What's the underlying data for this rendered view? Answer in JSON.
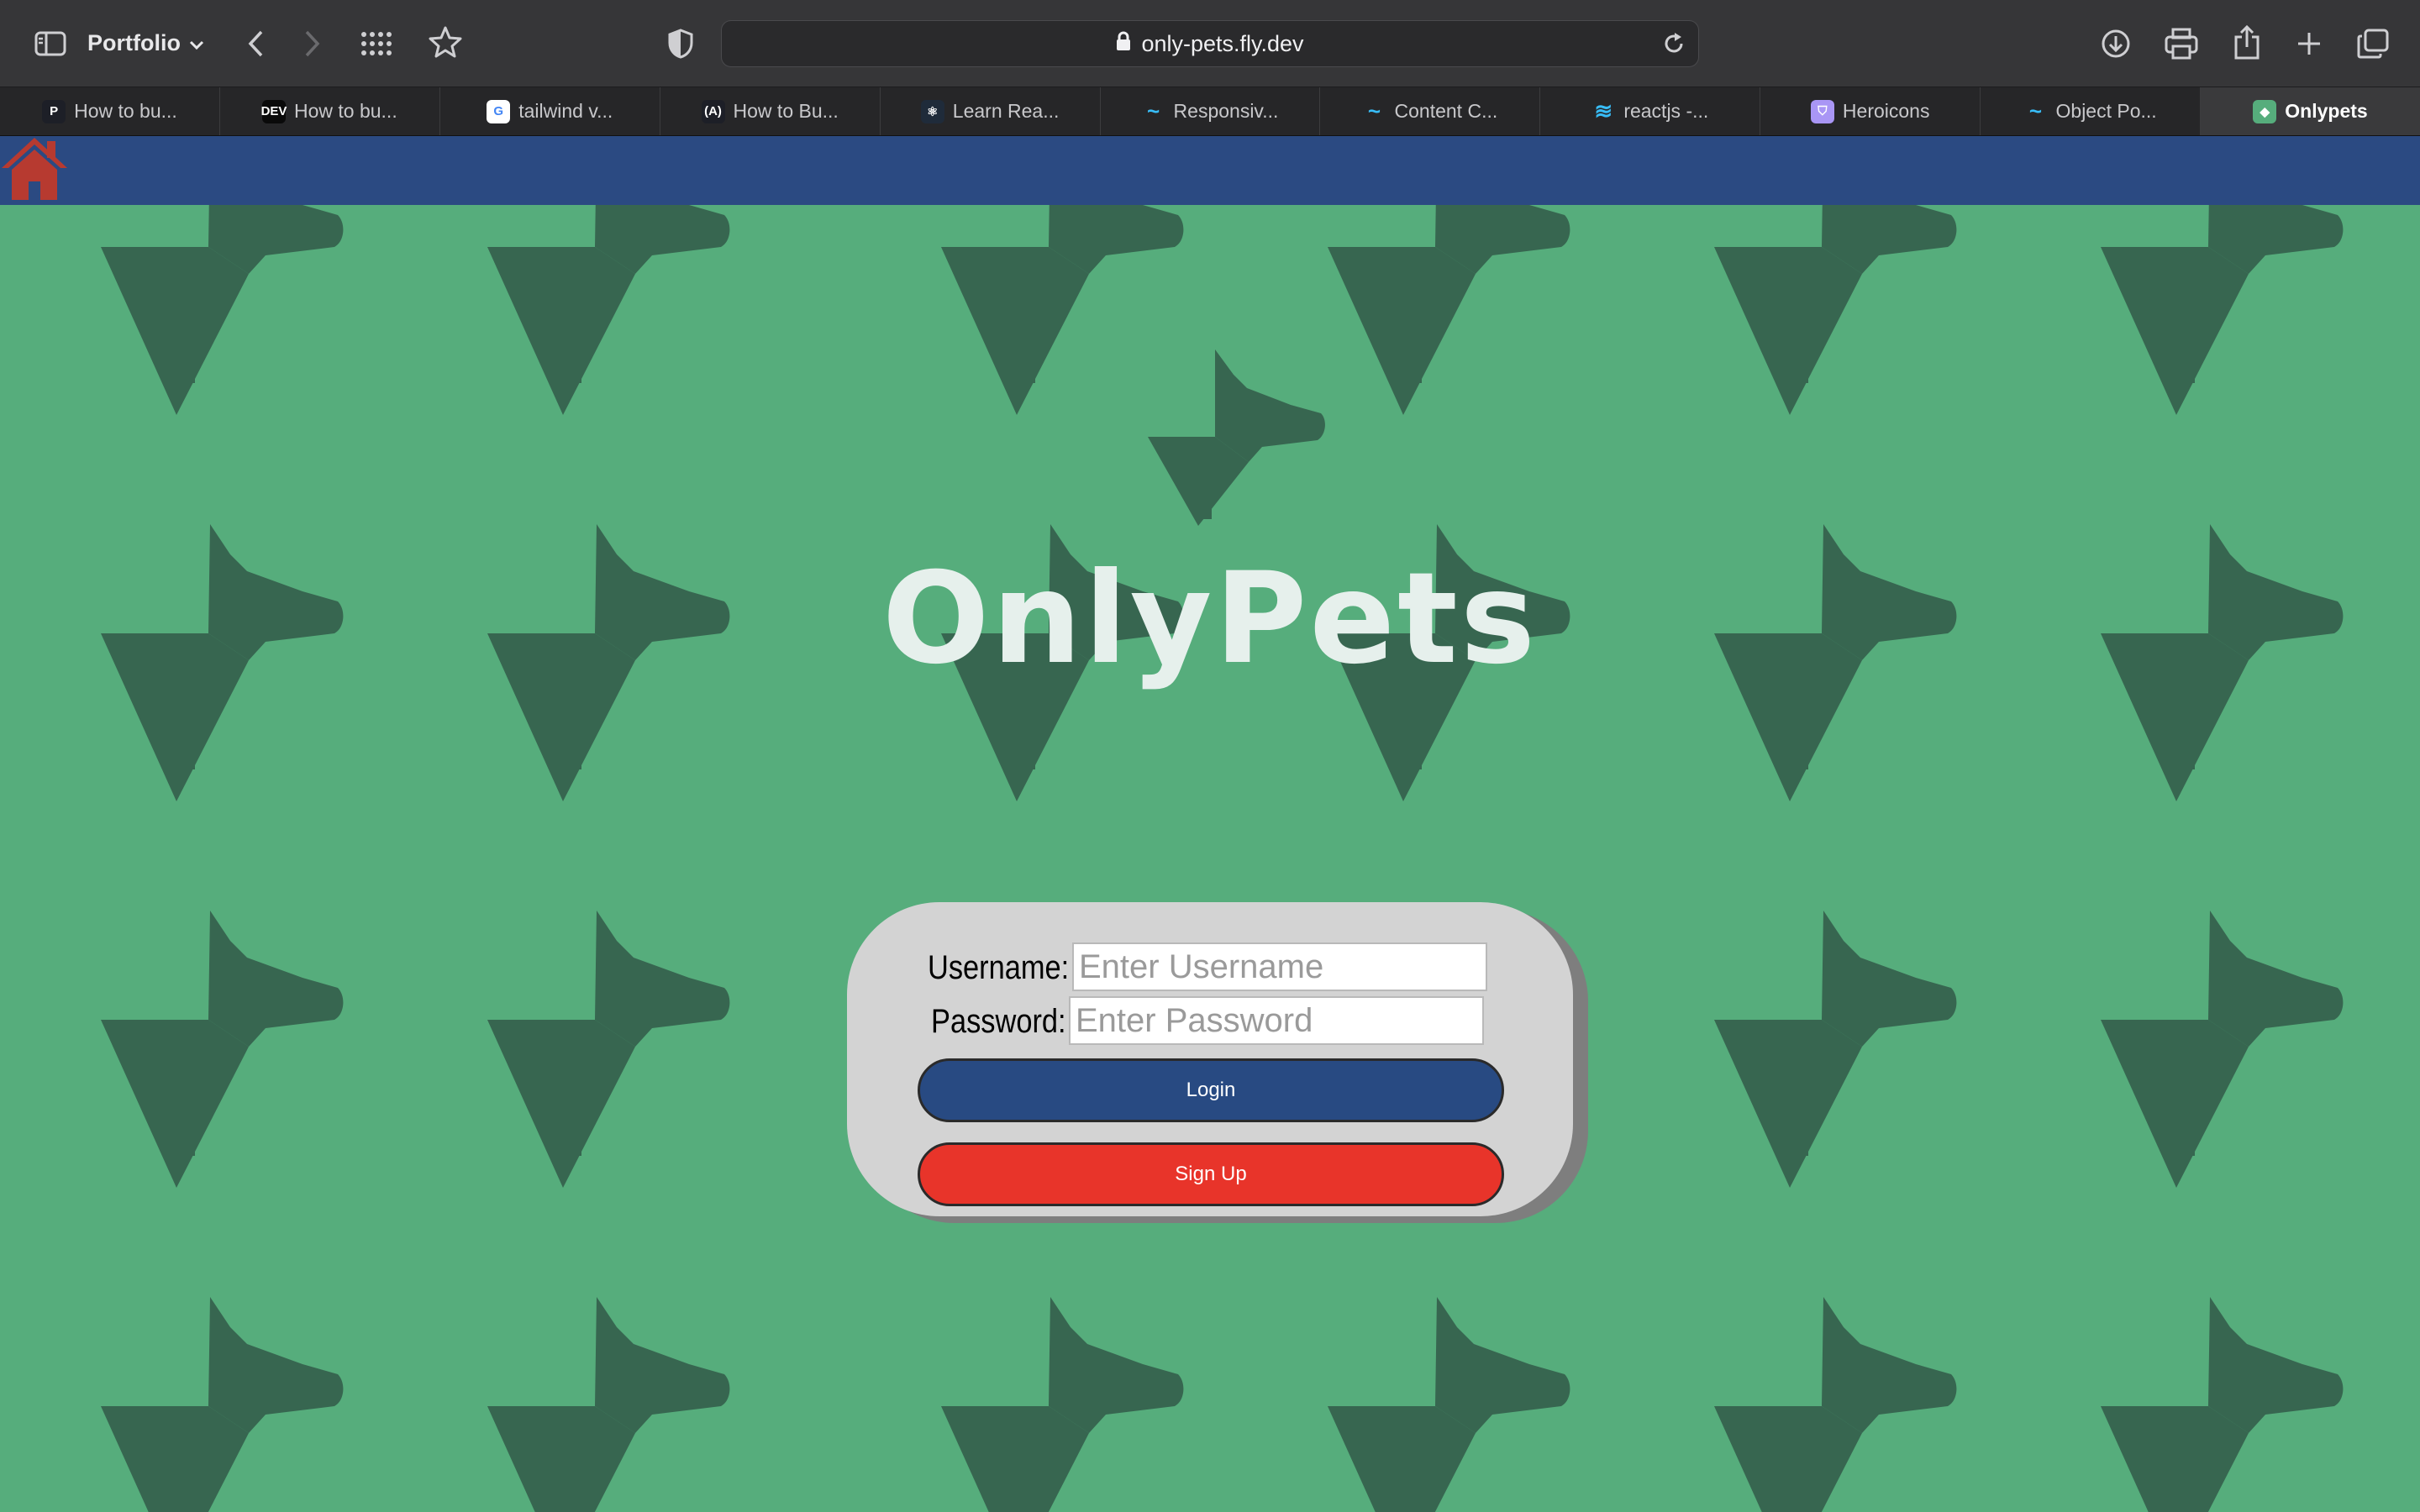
{
  "browser": {
    "profile_label": "Portfolio",
    "url": "only-pets.fly.dev",
    "icons": [
      "sidebar-icon",
      "chevron-down-icon",
      "back-icon",
      "forward-icon",
      "grid-icon",
      "star-icon",
      "shield-icon",
      "lock-icon",
      "reload-icon",
      "download-icon",
      "print-icon",
      "share-icon",
      "plus-icon",
      "tabs-icon"
    ],
    "tabs": [
      {
        "label": "How to bu...",
        "favicon": "P",
        "favicon_color": "#1d1f27"
      },
      {
        "label": "How to bu...",
        "favicon": "DEV",
        "favicon_color": "#0a0a0a"
      },
      {
        "label": "tailwind v...",
        "favicon": "G",
        "favicon_color": "#ffffff"
      },
      {
        "label": "How to Bu...",
        "favicon": "(A)",
        "favicon_color": "#1d1f27"
      },
      {
        "label": "Learn Rea...",
        "favicon": "⚛",
        "favicon_color": "#1f2b3a"
      },
      {
        "label": "Responsiv...",
        "favicon": "~",
        "favicon_color": "transparent"
      },
      {
        "label": "Content C...",
        "favicon": "~",
        "favicon_color": "transparent"
      },
      {
        "label": "reactjs -...",
        "favicon": "≋",
        "favicon_color": "transparent"
      },
      {
        "label": "Heroicons",
        "favicon": "⛉",
        "favicon_color": "#a996f5"
      },
      {
        "label": "Object Po...",
        "favicon": "~",
        "favicon_color": "transparent"
      },
      {
        "label": "Onlypets",
        "favicon": "◆",
        "favicon_color": "#56ad7c"
      }
    ],
    "active_tab_index": 10
  },
  "page": {
    "brand": "OnlyPets",
    "colors": {
      "background": "#56ad7c",
      "navbar": "#2b4a82",
      "home": "#b73a30",
      "login": "#284a82",
      "signup": "#e8342a",
      "card": "#d3d3d3"
    },
    "login_form": {
      "username_label": "Username:",
      "username_placeholder": "Enter Username",
      "password_label": "Password:",
      "password_placeholder": "Enter Password",
      "login_label": "Login",
      "signup_label": "Sign Up"
    }
  }
}
